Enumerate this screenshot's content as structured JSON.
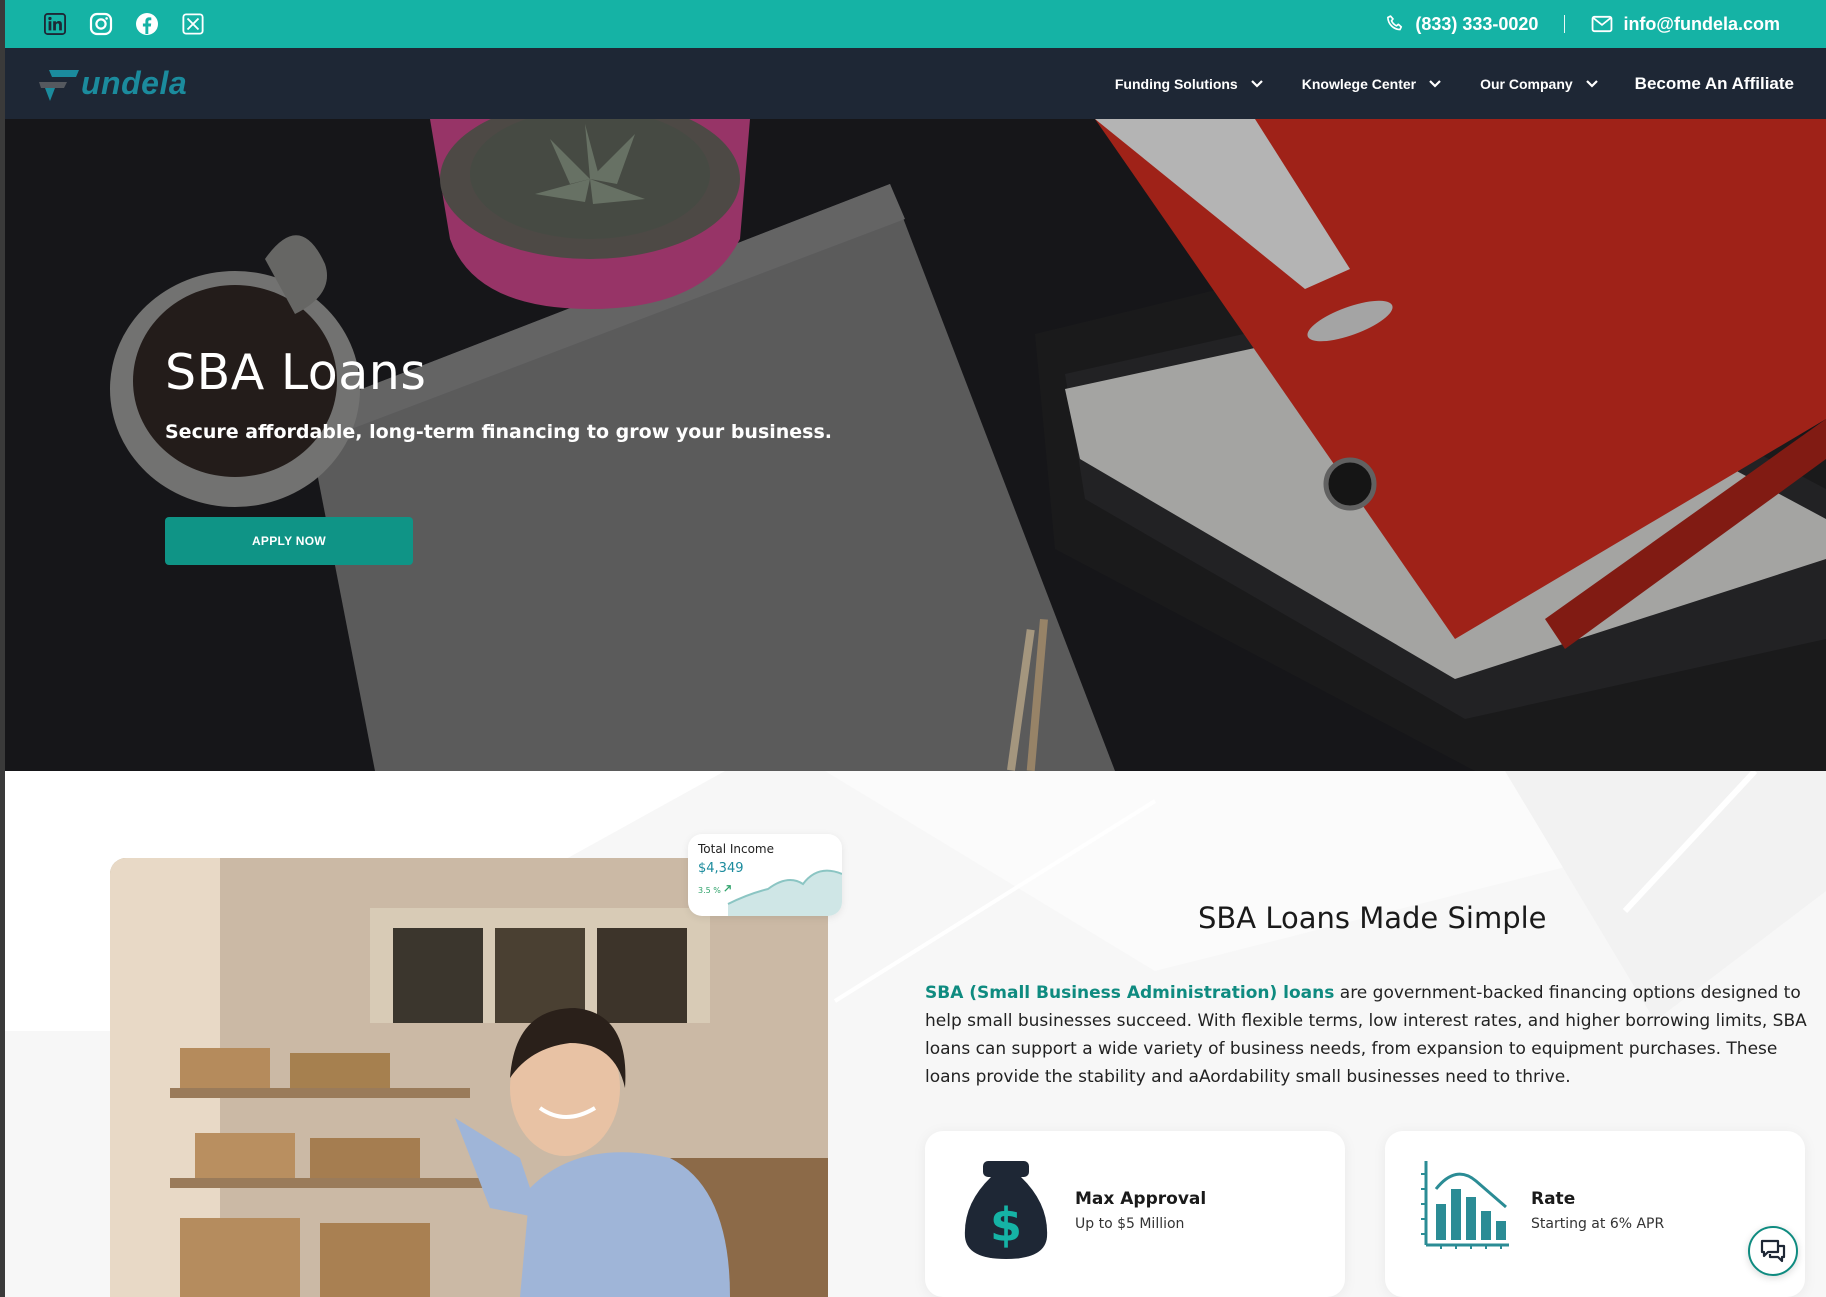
{
  "topbar": {
    "social_icons": [
      "linkedin-icon",
      "instagram-icon",
      "facebook-icon",
      "x-twitter-icon"
    ],
    "phone": "(833) 333-0020",
    "email": "info@fundela.com"
  },
  "nav": {
    "logo": "Fundela",
    "items": [
      {
        "label": "Funding Solutions",
        "has_dropdown": true
      },
      {
        "label": "Knowlege Center",
        "has_dropdown": true
      },
      {
        "label": "Our Company",
        "has_dropdown": true
      },
      {
        "label": "Become An Affiliate",
        "has_dropdown": false
      }
    ]
  },
  "hero": {
    "title": "SBA Loans",
    "subtitle": "Secure affordable, long-term financing to grow your business.",
    "cta": "APPLY NOW"
  },
  "income_card": {
    "title": "Total Income",
    "value": "$4,349",
    "change": "3.5 %"
  },
  "section": {
    "title": "SBA Loans Made Simple",
    "link_text": "SBA (Small Business Administration) loans",
    "body": " are government-backed financing options designed to help small businesses succeed. With flexible terms, low interest rates, and higher borrowing limits, SBA loans can support a wide variety of business needs, from expansion to equipment purchases. These loans provide the stability and aAordability small businesses need to thrive."
  },
  "cards": [
    {
      "icon": "money-bag-icon",
      "title": "Max Approval",
      "desc": "Up to $5 Million"
    },
    {
      "icon": "bar-chart-icon",
      "title": "Rate",
      "desc": "Starting at 6% APR"
    }
  ],
  "colors": {
    "teal": "#15b3a5",
    "nav_bg": "#1e2735",
    "button": "#0f9486",
    "link": "#0f8b80"
  },
  "chat_icon": "chat-icon"
}
